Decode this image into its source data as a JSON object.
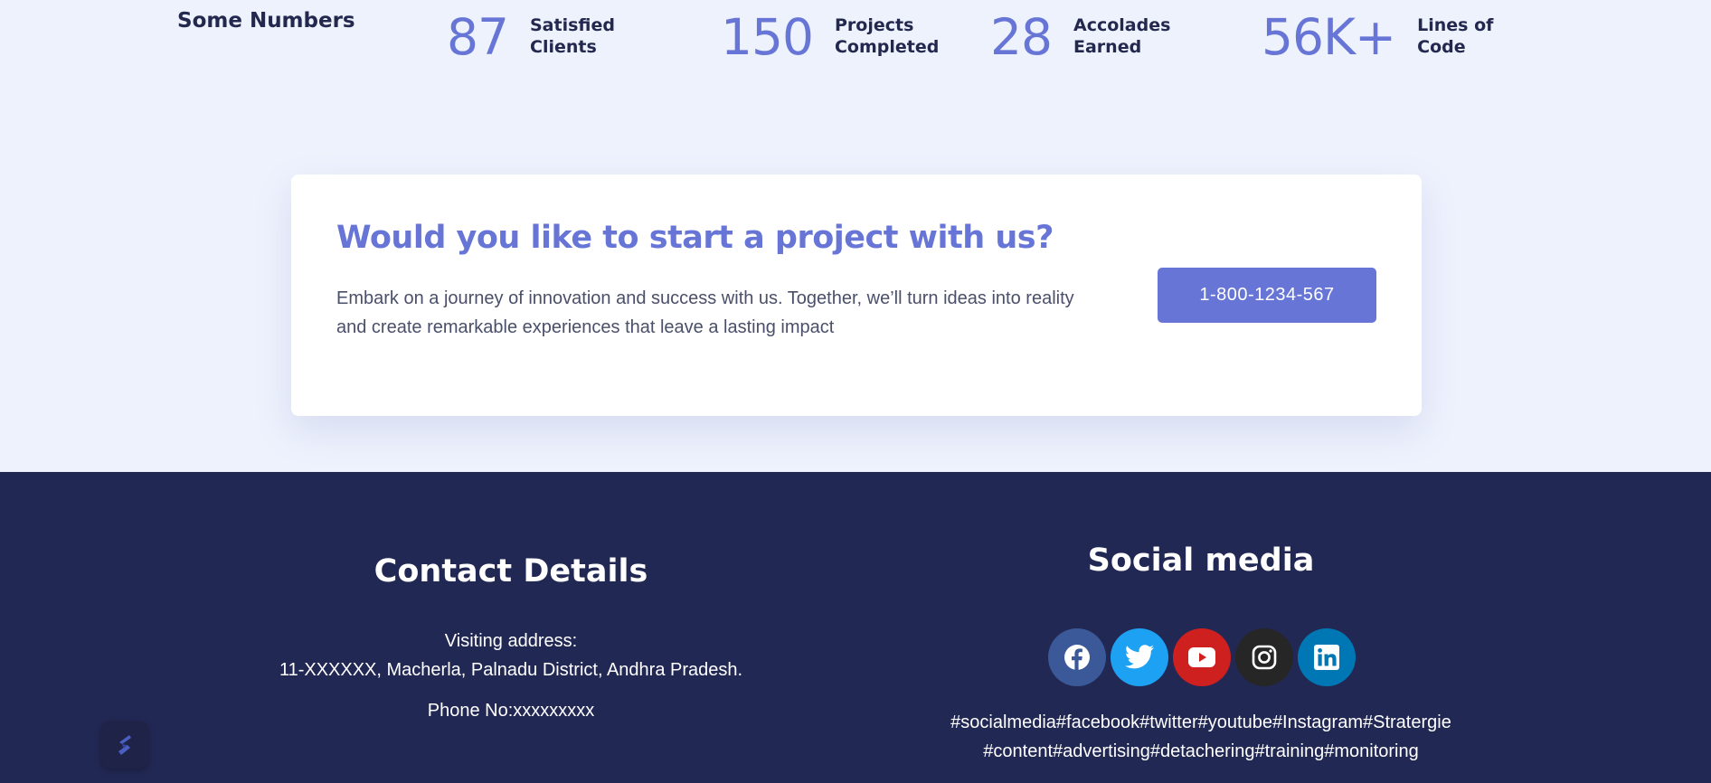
{
  "numbers": {
    "title": "Some Numbers",
    "stats": [
      {
        "value": "87",
        "label_line1": "Satisfied",
        "label_line2": "Clients"
      },
      {
        "value": "150",
        "label_line1": "Projects",
        "label_line2": "Completed"
      },
      {
        "value": "28",
        "label_line1": "Accolades",
        "label_line2": "Earned"
      },
      {
        "value": "56K+",
        "label_line1": "Lines of",
        "label_line2": "Code"
      }
    ]
  },
  "cta": {
    "title": "Would you like to start a project with us?",
    "text": "Embark on a journey of innovation and success with us. Together, we’ll turn ideas into reality and create remarkable experiences that leave a lasting impact",
    "button_label": "1-800-1234-567"
  },
  "contact": {
    "title": "Contact Details",
    "address_label": "Visiting address:",
    "address": "11-XXXXXX, Macherla, Palnadu District, Andhra Pradesh.",
    "phone": "Phone No:xxxxxxxxx"
  },
  "social": {
    "title": "Social media",
    "icons": [
      {
        "name": "facebook-icon",
        "color": "#3b5998"
      },
      {
        "name": "twitter-icon",
        "color": "#1da1f2"
      },
      {
        "name": "youtube-icon",
        "color": "#cd201f"
      },
      {
        "name": "instagram-icon",
        "color": "#262626"
      },
      {
        "name": "linkedin-icon",
        "color": "#0077b5"
      }
    ],
    "hashtags_line1": "#socialmedia#facebook#twitter#youtube#Instagram#Stratergie",
    "hashtags_line2": "#content#advertising#detachering#training#monitoring"
  },
  "colors": {
    "accent": "#6776d6",
    "footer_bg": "#222854",
    "page_bg": "#eef2fd"
  }
}
